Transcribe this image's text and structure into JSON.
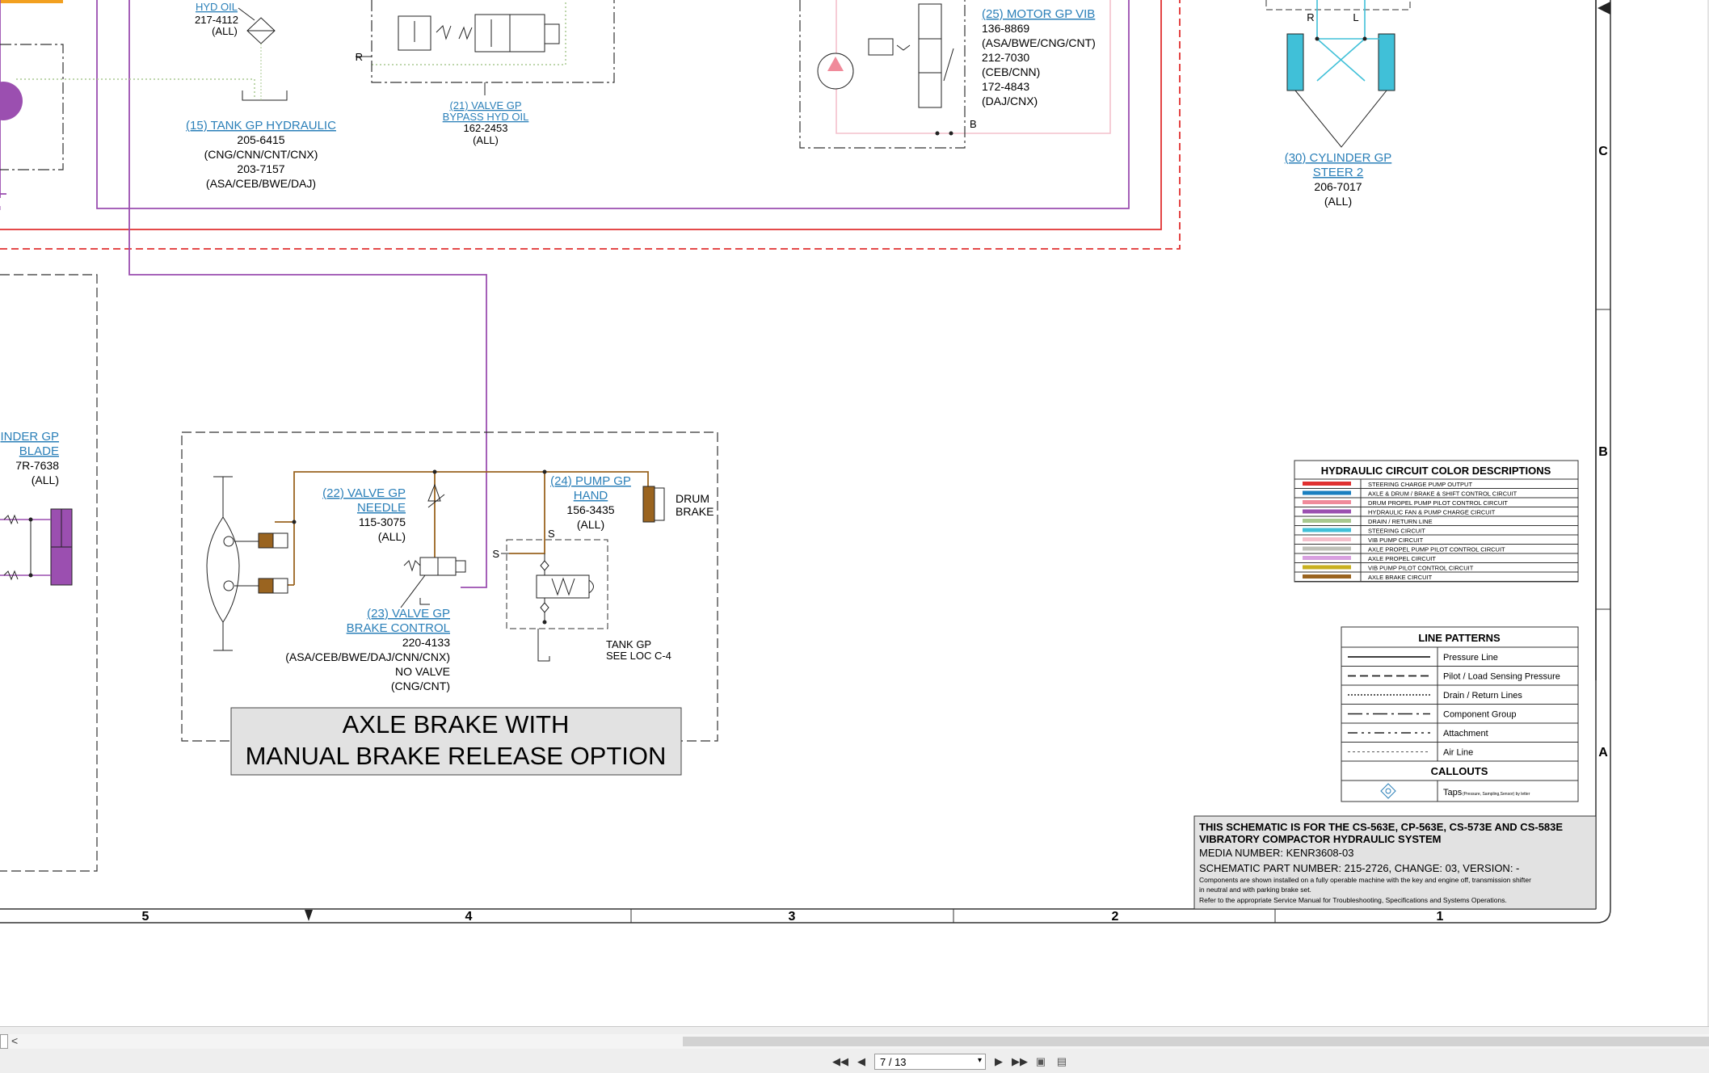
{
  "schematic": {
    "components": {
      "hyd_oil": {
        "title": "HYD OIL",
        "pn": "217-4112",
        "cfg": "(ALL)"
      },
      "tank": {
        "title": "(15) TANK GP HYDRAULIC",
        "pn1": "205-6415",
        "cfg1": "(CNG/CNN/CNT/CNX)",
        "pn2": "203-7157",
        "cfg2": "(ASA/CEB/BWE/DAJ)"
      },
      "bypass": {
        "title1": "(21) VALVE GP",
        "title2": "BYPASS HYD OIL",
        "pn": "162-2453",
        "cfg": "(ALL)"
      },
      "motor": {
        "title": "(25) MOTOR GP VIB",
        "pn1": "136-8869",
        "cfg1": "(ASA/BWE/CNG/CNT)",
        "pn2": "212-7030",
        "cfg2": "(CEB/CNN)",
        "pn3": "172-4843",
        "cfg3": "(DAJ/CNX)"
      },
      "cyl_steer": {
        "title1": "(30) CYLINDER GP",
        "title2": "STEER 2",
        "pn": "206-7017",
        "cfg": "(ALL)"
      },
      "cyl_blade": {
        "title1": "INDER GP",
        "title2": "BLADE",
        "pn": "7R-7638",
        "cfg": "(ALL)"
      },
      "needle": {
        "title1": "(22) VALVE GP",
        "title2": "NEEDLE",
        "pn": "115-3075",
        "cfg": "(ALL)"
      },
      "pump_hand": {
        "title1": "(24) PUMP GP",
        "title2": "HAND",
        "pn": "156-3435",
        "cfg": "(ALL)"
      },
      "drum_brake": {
        "line1": "DRUM",
        "line2": "BRAKE"
      },
      "brake_ctrl": {
        "title1": "(23) VALVE GP",
        "title2": "BRAKE CONTROL",
        "pn": "220-4133",
        "cfg": "(ASA/CEB/BWE/DAJ/CNN/CNX)",
        "novalve": "NO VALVE",
        "novalve_cfg": "(CNG/CNT)"
      },
      "tank_ref": {
        "line1": "TANK GP",
        "line2": "SEE LOC C-4"
      }
    },
    "port_labels": {
      "r_left": "R",
      "r_top": "R",
      "l_top": "L",
      "b": "B",
      "s1": "S",
      "s2": "S"
    },
    "option_box": {
      "line1": "AXLE BRAKE WITH",
      "line2": "MANUAL BRAKE RELEASE OPTION"
    },
    "zones": {
      "col5": "5",
      "col4": "4",
      "col3": "3",
      "col2": "2",
      "col1": "1",
      "rowC": "C",
      "rowB": "B",
      "rowA": "A"
    },
    "color_legend": {
      "title": "HYDRAULIC CIRCUIT COLOR DESCRIPTIONS",
      "items": [
        {
          "color": "#e03030",
          "label": "STEERING CHARGE PUMP OUTPUT"
        },
        {
          "color": "#1a7fc0",
          "label": "AXLE & DRUM / BRAKE & SHIFT CONTROL CIRCUIT"
        },
        {
          "color": "#f08a9a",
          "label": "DRUM PROPEL PUMP PILOT CONTROL CIRCUIT"
        },
        {
          "color": "#9b4fb0",
          "label": "HYDRAULIC FAN & PUMP CHARGE CIRCUIT"
        },
        {
          "color": "#a8c890",
          "label": "DRAIN / RETURN LINE"
        },
        {
          "color": "#40c0d8",
          "label": "STEERING CIRCUIT"
        },
        {
          "color": "#f4c0cc",
          "label": "VIB PUMP CIRCUIT"
        },
        {
          "color": "#c0c0b8",
          "label": "AXLE PROPEL PUMP PILOT CONTROL CIRCUIT"
        },
        {
          "color": "#d8a0e0",
          "label": "AXLE PROPEL CIRCUIT"
        },
        {
          "color": "#c8b020",
          "label": "VIB PUMP PILOT CONTROL CIRCUIT"
        },
        {
          "color": "#9a6420",
          "label": "AXLE BRAKE CIRCUIT"
        }
      ]
    },
    "line_patterns": {
      "title": "LINE PATTERNS",
      "items": [
        {
          "label": "Pressure Line"
        },
        {
          "label": "Pilot / Load Sensing Pressure"
        },
        {
          "label": "Drain / Return Lines"
        },
        {
          "label": "Component Group"
        },
        {
          "label": "Attachment"
        },
        {
          "label": "Air Line"
        }
      ],
      "callouts_title": "CALLOUTS",
      "taps_label": "Taps",
      "taps_note": "(Pressure, Sampling,Sensor) by letter"
    },
    "title_block": {
      "line1": "THIS SCHEMATIC IS FOR THE CS-563E, CP-563E, CS-573E AND CS-583E",
      "line2": "VIBRATORY COMPACTOR HYDRAULIC SYSTEM",
      "media": "MEDIA NUMBER: KENR3608-03",
      "part": "SCHEMATIC PART NUMBER: 215-2726, CHANGE: 03, VERSION: -",
      "note1": "Components are shown installed on a fully operable machine with the key and engine off, transmission shifter",
      "note2": "in neutral and with parking brake set.",
      "note3": "Refer to the appropriate Service Manual for Troubleshooting, Specifications and Systems Operations."
    }
  },
  "viewer": {
    "page_indicator": "7 / 13",
    "nav_first_icon": "skip-first-icon",
    "nav_prev_icon": "prev-page-icon",
    "nav_next_icon": "next-page-icon",
    "nav_last_icon": "skip-last-icon"
  }
}
